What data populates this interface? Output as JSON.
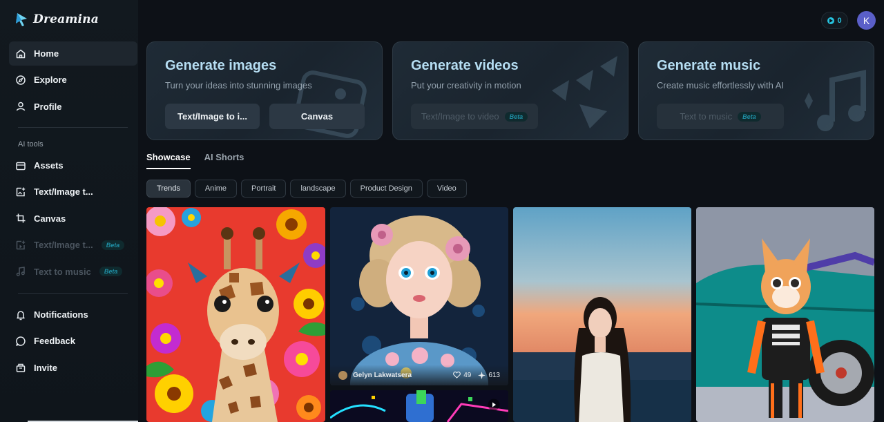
{
  "brand": {
    "name": "Dreamina"
  },
  "header": {
    "credits": "0",
    "avatar_initial": "K"
  },
  "sidebar": {
    "main_items": [
      {
        "label": "Home",
        "icon": "home-icon",
        "active": true
      },
      {
        "label": "Explore",
        "icon": "compass-icon"
      },
      {
        "label": "Profile",
        "icon": "user-icon"
      }
    ],
    "section_label": "AI tools",
    "tool_items": [
      {
        "label": "Assets",
        "icon": "folder-icon"
      },
      {
        "label": "Text/Image t...",
        "icon": "image-add-icon"
      },
      {
        "label": "Canvas",
        "icon": "crop-icon"
      },
      {
        "label": "Text/Image t...",
        "icon": "video-add-icon",
        "badge": "Beta",
        "disabled": true
      },
      {
        "label": "Text to music",
        "icon": "music-icon",
        "badge": "Beta",
        "disabled": true
      }
    ],
    "bottom_items": [
      {
        "label": "Notifications",
        "icon": "bell-icon"
      },
      {
        "label": "Feedback",
        "icon": "feedback-icon"
      },
      {
        "label": "Invite",
        "icon": "invite-icon"
      }
    ]
  },
  "cards": [
    {
      "title": "Generate images",
      "subtitle": "Turn your ideas into stunning images",
      "buttons": [
        {
          "label": "Text/Image to i..."
        },
        {
          "label": "Canvas"
        }
      ]
    },
    {
      "title": "Generate videos",
      "subtitle": "Put your creativity in motion",
      "buttons": [
        {
          "label": "Text/Image to video",
          "badge": "Beta"
        }
      ]
    },
    {
      "title": "Generate music",
      "subtitle": "Create music effortlessly with AI",
      "buttons": [
        {
          "label": "Text to music",
          "badge": "Beta"
        }
      ]
    }
  ],
  "tabs": [
    {
      "label": "Showcase",
      "active": true
    },
    {
      "label": "AI Shorts"
    }
  ],
  "filters": [
    "Trends",
    "Anime",
    "Portrait",
    "landscape",
    "Product Design",
    "Video"
  ],
  "gallery": {
    "featured": {
      "author": "Gelyn Lakwatsera",
      "likes": "49",
      "uses": "613"
    }
  }
}
